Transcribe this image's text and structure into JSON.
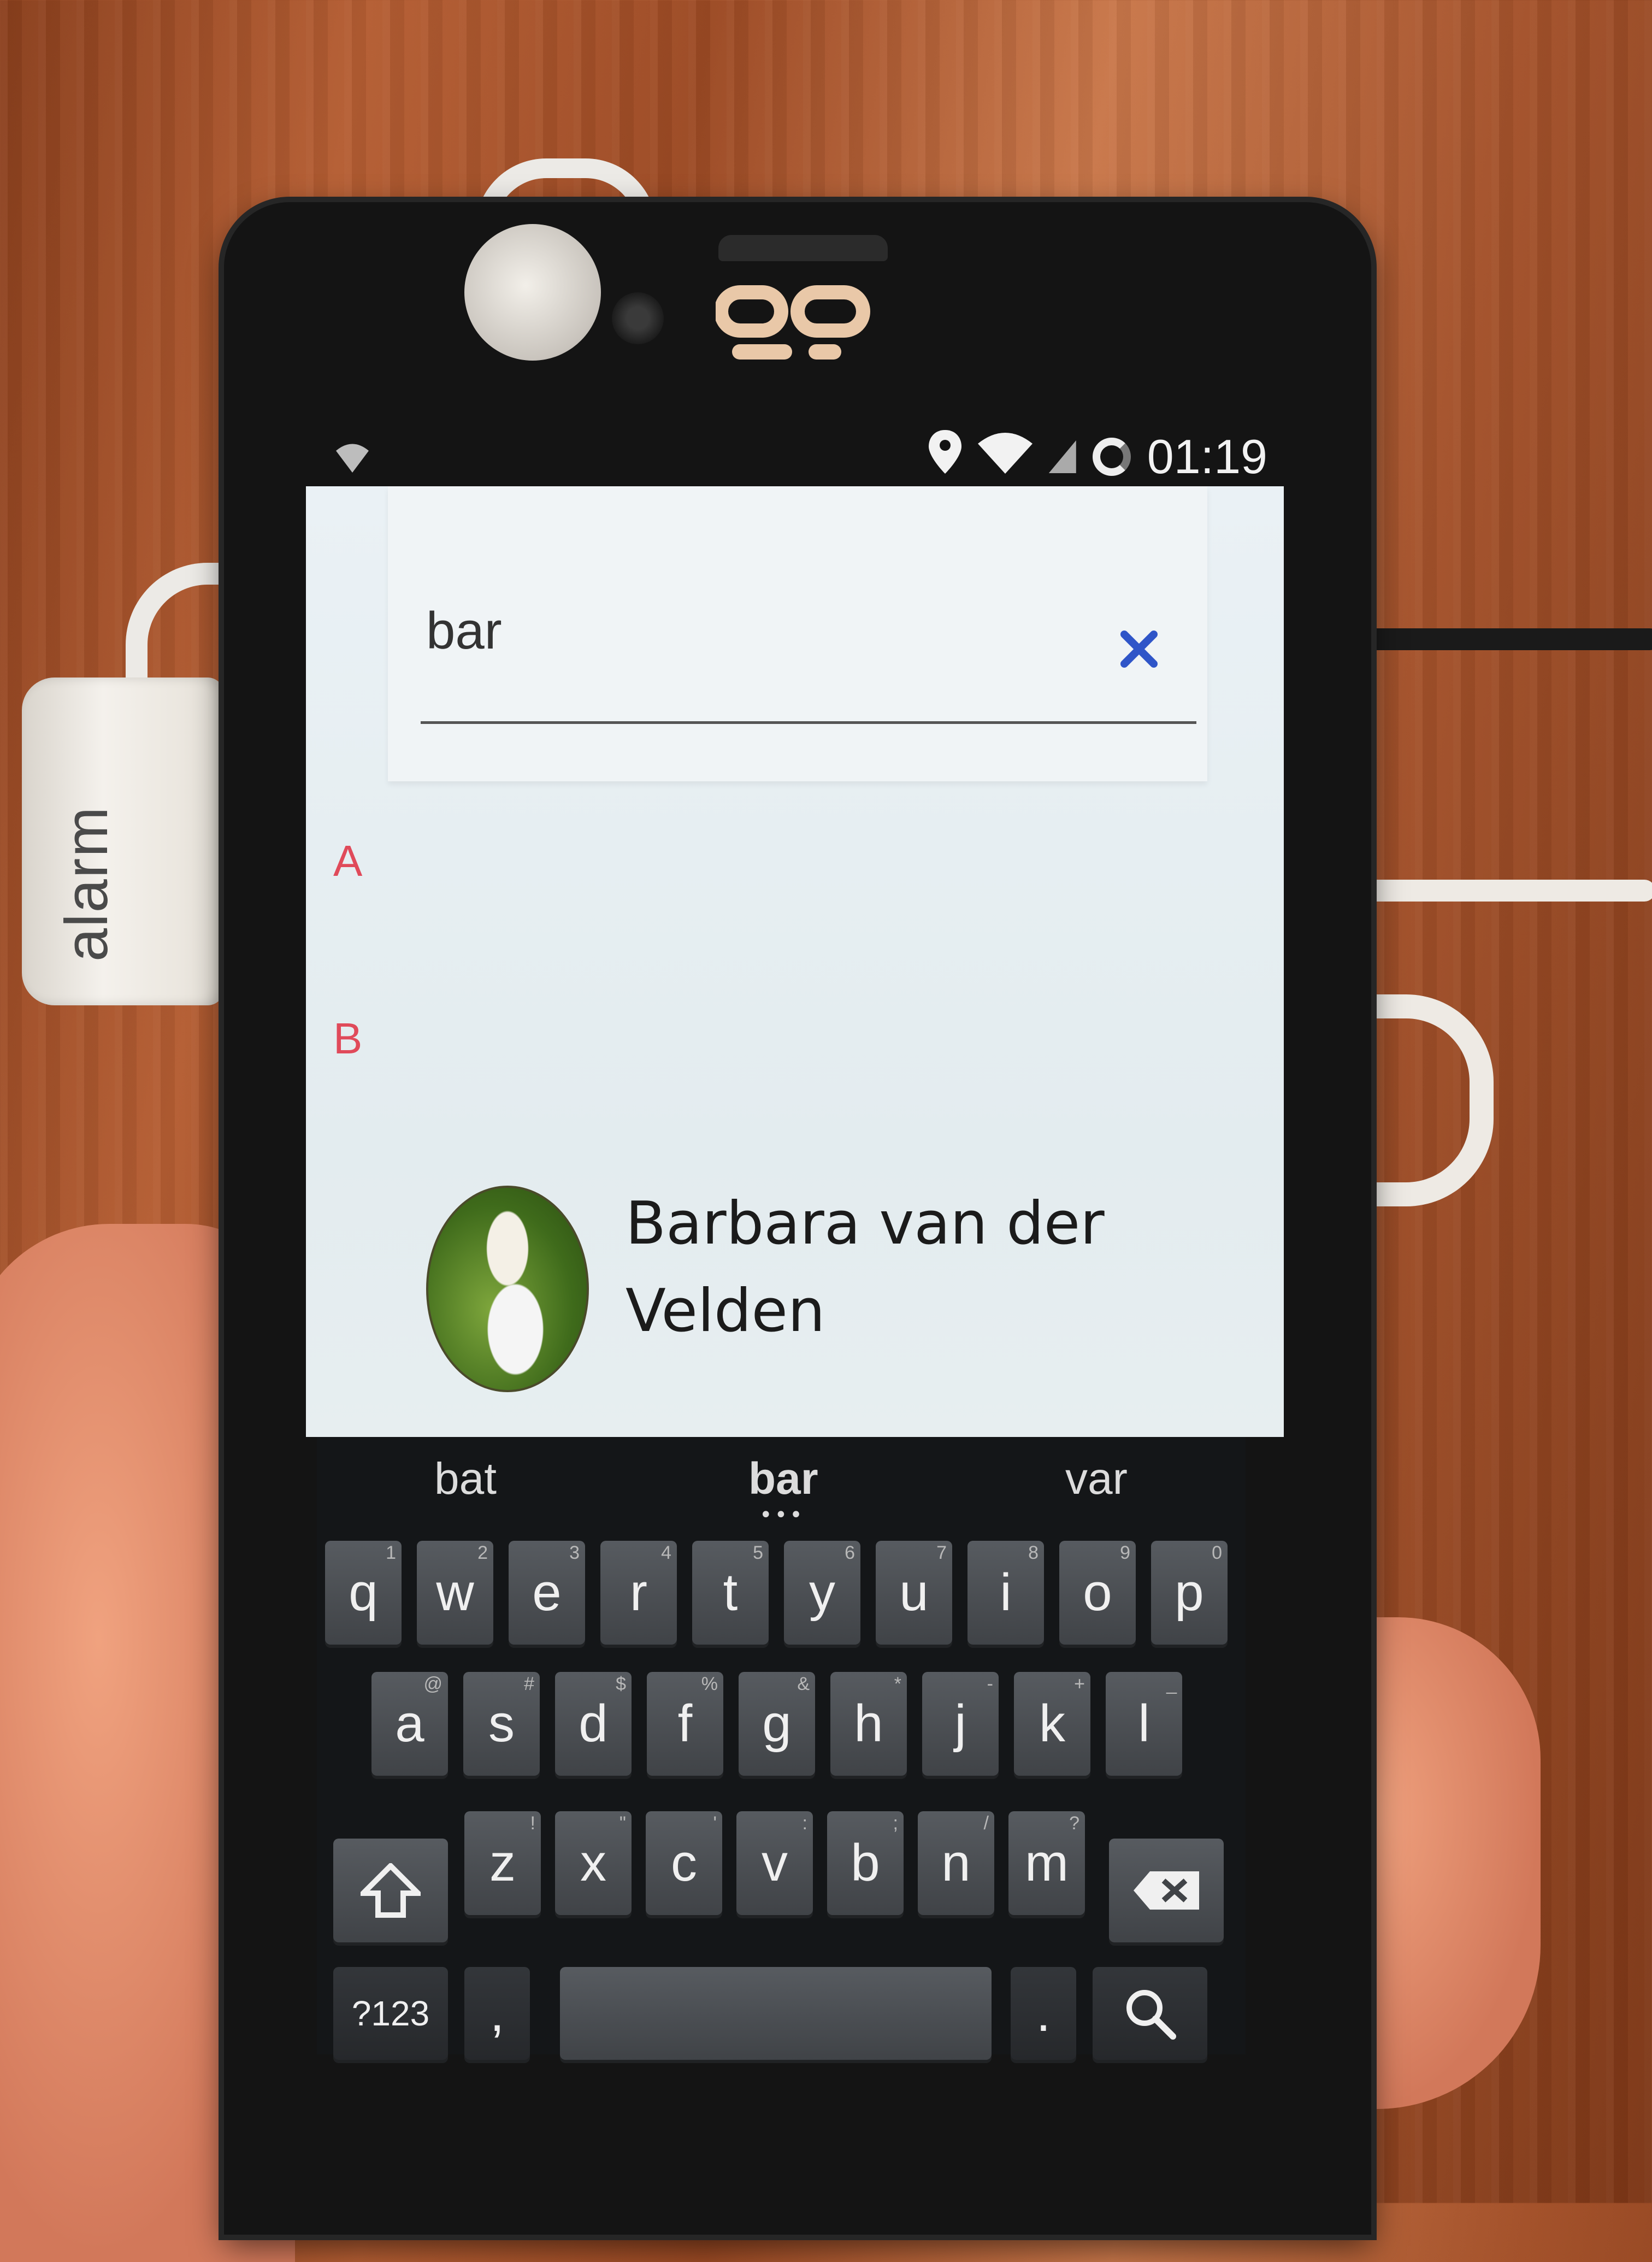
{
  "device": {
    "logo": "ᵒ̲᷊ᴞ"
  },
  "tag": {
    "label": "alarm"
  },
  "status_bar": {
    "time": "01:19"
  },
  "search": {
    "query": "bar"
  },
  "index_letters": [
    "A",
    "B"
  ],
  "results": [
    {
      "name": "Barbara van der Velden"
    }
  ],
  "keyboard": {
    "suggestions": [
      "bat",
      "bar",
      "var"
    ],
    "row1": [
      {
        "k": "q",
        "alt": "1"
      },
      {
        "k": "w",
        "alt": "2"
      },
      {
        "k": "e",
        "alt": "3"
      },
      {
        "k": "r",
        "alt": "4"
      },
      {
        "k": "t",
        "alt": "5"
      },
      {
        "k": "y",
        "alt": "6"
      },
      {
        "k": "u",
        "alt": "7"
      },
      {
        "k": "i",
        "alt": "8"
      },
      {
        "k": "o",
        "alt": "9"
      },
      {
        "k": "p",
        "alt": "0"
      }
    ],
    "row2": [
      {
        "k": "a",
        "alt": "@"
      },
      {
        "k": "s",
        "alt": "#"
      },
      {
        "k": "d",
        "alt": "$"
      },
      {
        "k": "f",
        "alt": "%"
      },
      {
        "k": "g",
        "alt": "&"
      },
      {
        "k": "h",
        "alt": "*"
      },
      {
        "k": "j",
        "alt": "-"
      },
      {
        "k": "k",
        "alt": "+"
      },
      {
        "k": "l",
        "alt": "_"
      }
    ],
    "row3": [
      {
        "k": "z",
        "alt": "!"
      },
      {
        "k": "x",
        "alt": "\""
      },
      {
        "k": "c",
        "alt": "'"
      },
      {
        "k": "v",
        "alt": ":"
      },
      {
        "k": "b",
        "alt": ";"
      },
      {
        "k": "n",
        "alt": "/"
      },
      {
        "k": "m",
        "alt": "?"
      }
    ],
    "symbols_label": "?123",
    "comma": ",",
    "period": "."
  }
}
